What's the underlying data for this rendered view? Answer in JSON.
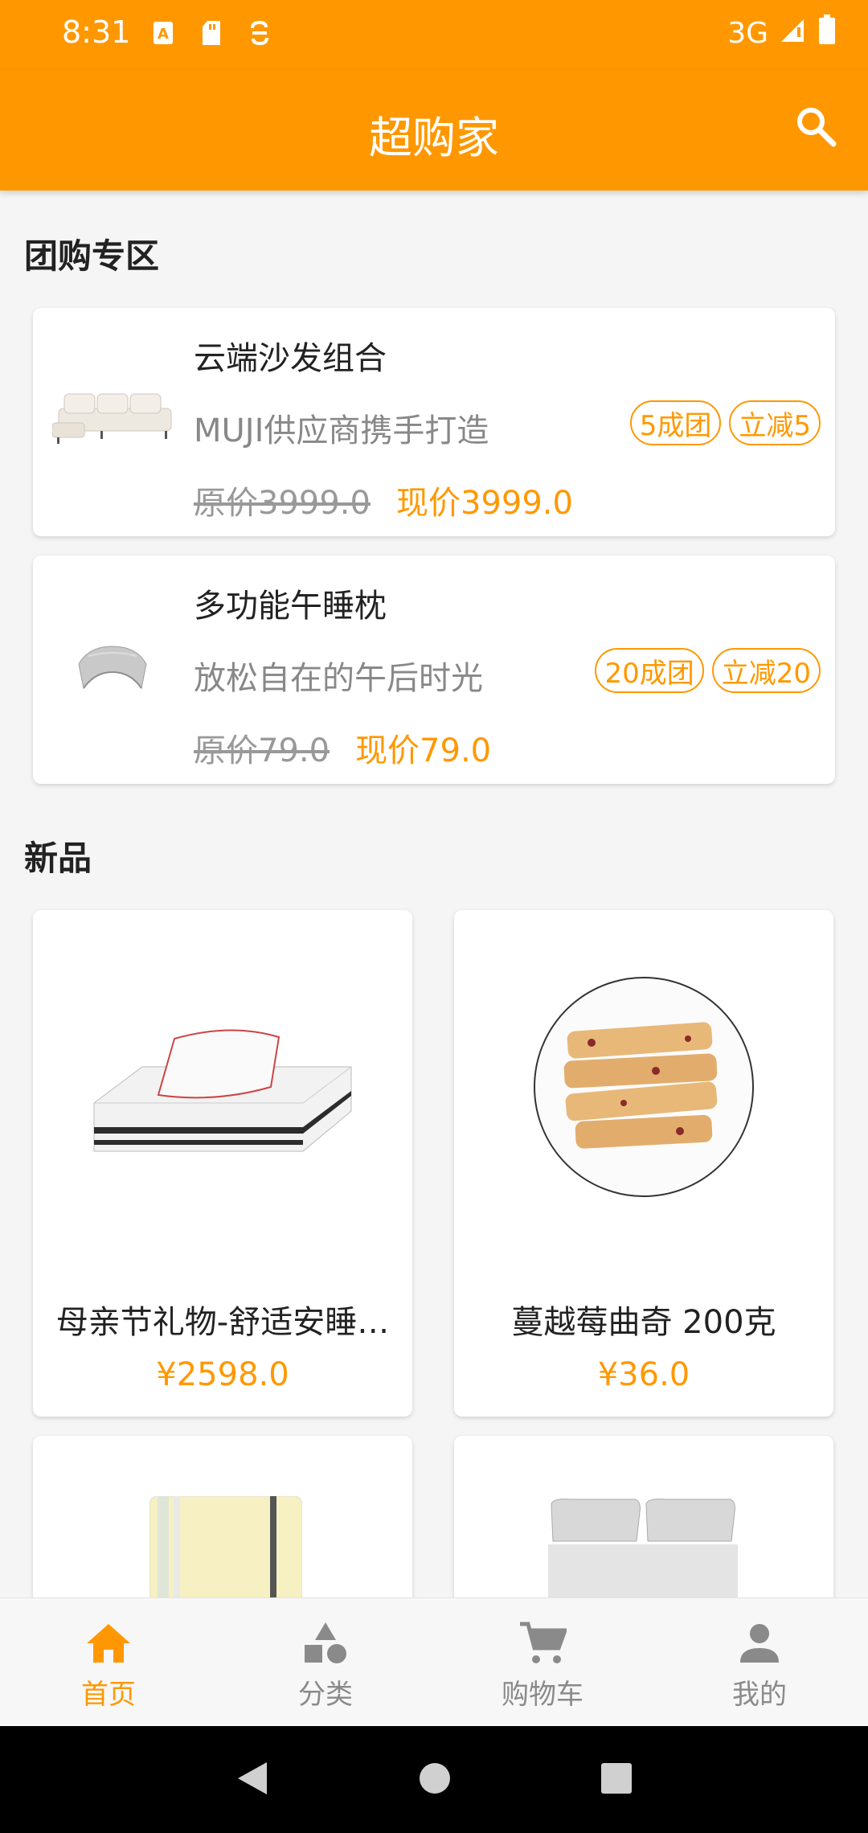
{
  "status_bar": {
    "time": "8:31",
    "network": "3G"
  },
  "app_bar": {
    "title": "超购家"
  },
  "group_section": {
    "title": "团购专区",
    "items": [
      {
        "name": "云端沙发组合",
        "subtitle": "MUJI供应商携手打造",
        "badges": [
          "5成团",
          "立减5"
        ],
        "original_price": "原价3999.0",
        "current_price": "现价3999.0",
        "image_icon": "sofa-image"
      },
      {
        "name": "多功能午睡枕",
        "subtitle": "放松自在的午后时光",
        "badges": [
          "20成团",
          "立减20"
        ],
        "original_price": "原价79.0",
        "current_price": "现价79.0",
        "image_icon": "pillow-image"
      }
    ]
  },
  "new_section": {
    "title": "新品",
    "products": [
      {
        "name": "母亲节礼物-舒适安睡…",
        "price": "¥2598.0",
        "image_icon": "mattress-image"
      },
      {
        "name": "蔓越莓曲奇 200克",
        "price": "¥36.0",
        "image_icon": "cookies-image"
      },
      {
        "name": "",
        "price": "",
        "image_icon": "notebook-image"
      },
      {
        "name": "",
        "price": "",
        "image_icon": "bed-image"
      }
    ]
  },
  "bottom_nav": {
    "items": [
      {
        "label": "首页",
        "icon": "home-icon",
        "active": true
      },
      {
        "label": "分类",
        "icon": "category-icon",
        "active": false
      },
      {
        "label": "购物车",
        "icon": "cart-icon",
        "active": false
      },
      {
        "label": "我的",
        "icon": "person-icon",
        "active": false
      }
    ]
  },
  "colors": {
    "accent": "#FF9800",
    "text": "#222222",
    "muted": "#888888"
  }
}
